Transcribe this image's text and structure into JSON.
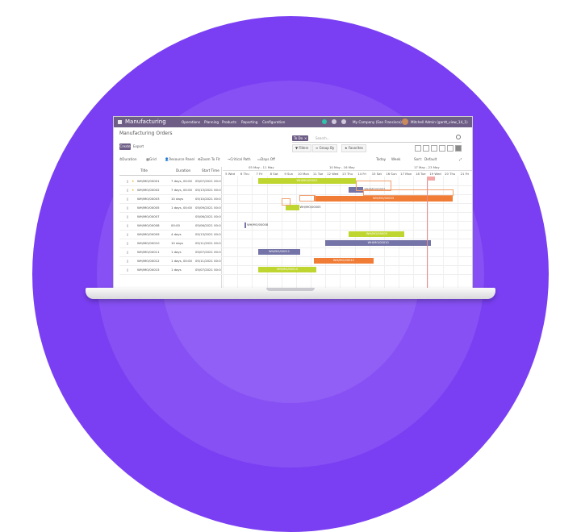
{
  "colors": {
    "bg_purple": "#7a3ff2",
    "navbar": "#6e5e86",
    "bar_green": "#c0d630",
    "bar_purple": "#7574a8",
    "bar_orange": "#f07c36",
    "today": "#e78b8b"
  },
  "navbar": {
    "brand": "Manufacturing",
    "menu": [
      "Operations",
      "Planning",
      "Products",
      "Reporting",
      "Configuration"
    ],
    "company": "My Company (San Francisco)",
    "user": "Mitchell Admin (gantt_view_14_1)"
  },
  "page": {
    "breadcrumb": "Manufacturing Orders",
    "create": "Create",
    "export": "Export"
  },
  "search": {
    "facet": "To Do",
    "placeholder": "Search..."
  },
  "control": {
    "filters": "Filters",
    "group_by": "Group By",
    "favorites": "Favorites"
  },
  "gantt_toolbar": {
    "duration": "Duration",
    "grid": "Grid",
    "resource_panel": "Resource Panel",
    "zoom_to_fit": "Zoom To Fit",
    "critical_path": "Critical Path",
    "days_off": "Days Off",
    "today": "Today",
    "scale": "Week",
    "sort_label": "Sort:",
    "sort_value": "Default"
  },
  "columns": {
    "title": "Title",
    "duration": "Duration",
    "start_time": "Start Time"
  },
  "weeks": [
    "05 May - 11 May",
    "10 May - 16 May",
    "17 May - 23 May"
  ],
  "days": [
    "5 Wed",
    "6 Thu",
    "7 Fri",
    "8 Sat",
    "9 Sun",
    "10 Mon",
    "11 Tue",
    "12 Wed",
    "13 Thu",
    "14 Fri",
    "15 Sat",
    "16 Sun",
    "17 Mon",
    "18 Tue",
    "19 Wed",
    "20 Thu",
    "21 Fri"
  ],
  "rows": [
    {
      "title": "WH/MO/00001",
      "duration": "7 days, 00:00",
      "start": "05/07/2021 00:0",
      "starred": true,
      "bar_label": "WH/MO/00001"
    },
    {
      "title": "WH/MO/00002",
      "duration": "7 days, 00:00",
      "start": "05/13/2021 00:0",
      "starred": true,
      "bar_label": "WH/MO/00002"
    },
    {
      "title": "WH/MO/00003",
      "duration": "10 days",
      "start": "05/10/2021 00:0",
      "starred": false,
      "bar_label": "WH/MO/00003"
    },
    {
      "title": "WH/MO/00005",
      "duration": "1 days, 00:00",
      "start": "05/09/2021 00:0",
      "starred": false,
      "bar_label": "WH/MO/00005"
    },
    {
      "title": "WH/MO/00007",
      "duration": "",
      "start": "05/06/2021 00:0",
      "starred": false,
      "bar_label": ""
    },
    {
      "title": "WH/MO/00008",
      "duration": "00:00",
      "start": "05/06/2021 00:0",
      "starred": false,
      "bar_label": "WH/MO/00008"
    },
    {
      "title": "WH/MO/00009",
      "duration": "4 days",
      "start": "05/13/2021 00:0",
      "starred": false,
      "bar_label": "WH/MO/00009"
    },
    {
      "title": "WH/MO/00010",
      "duration": "10 days",
      "start": "05/11/2021 00:0",
      "starred": false,
      "bar_label": "WH/MO/00010"
    },
    {
      "title": "WH/MO/00011",
      "duration": "1 days",
      "start": "05/07/2021 00:0",
      "starred": false,
      "bar_label": "WH/MO/00011"
    },
    {
      "title": "WH/MO/00012",
      "duration": "1 days, 00:00",
      "start": "05/11/2021 00:0",
      "starred": false,
      "bar_label": "WH/MO/00012"
    },
    {
      "title": "WH/MO/00015",
      "duration": "1 days",
      "start": "05/07/2021 00:0",
      "starred": false,
      "bar_label": "WH/MO/00015"
    }
  ]
}
